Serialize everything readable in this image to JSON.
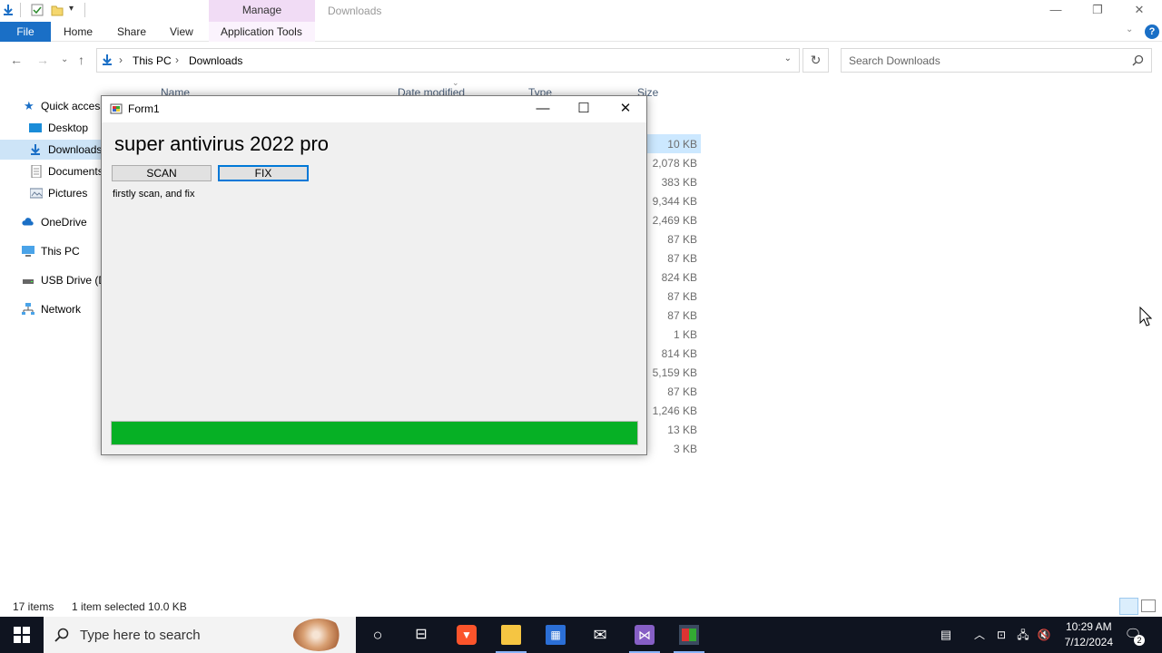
{
  "explorer": {
    "title": "Downloads",
    "ribbon_context_label": "Manage",
    "tabs": [
      "File",
      "Home",
      "Share",
      "View",
      "Application Tools"
    ],
    "breadcrumb": [
      "This PC",
      "Downloads"
    ],
    "search_placeholder": "Search Downloads",
    "columns": [
      "Name",
      "Date modified",
      "Type",
      "Size"
    ],
    "sidebar": [
      {
        "label": "Quick access"
      },
      {
        "label": "Desktop"
      },
      {
        "label": "Downloads"
      },
      {
        "label": "Documents"
      },
      {
        "label": "Pictures"
      },
      {
        "label": "OneDrive"
      },
      {
        "label": "This PC"
      },
      {
        "label": "USB Drive (D:)"
      },
      {
        "label": "Network"
      }
    ],
    "sizes": [
      "10 KB",
      "2,078 KB",
      "383 KB",
      "9,344 KB",
      "2,469 KB",
      "87 KB",
      "87 KB",
      "824 KB",
      "87 KB",
      "87 KB",
      "1 KB",
      "814 KB",
      "5,159 KB",
      "87 KB",
      "1,246 KB",
      "13 KB",
      "3 KB"
    ],
    "status": {
      "items": "17 items",
      "selection": "1 item selected  10.0 KB"
    }
  },
  "form": {
    "title": "Form1",
    "heading": "super antivirus 2022 pro",
    "scan_label": "SCAN",
    "fix_label": "FIX",
    "hint": "firstly scan, and fix",
    "progress": 1.0,
    "progress_color": "#06b025"
  },
  "taskbar": {
    "search_placeholder": "Type here to search",
    "time": "10:29 AM",
    "date": "7/12/2024",
    "notification_count": "2"
  },
  "colors": {
    "file_tab": "#1a6fc6",
    "context_tab": "#f1dcf5",
    "selection": "#cde4f7",
    "taskbar": "#0f1420"
  }
}
